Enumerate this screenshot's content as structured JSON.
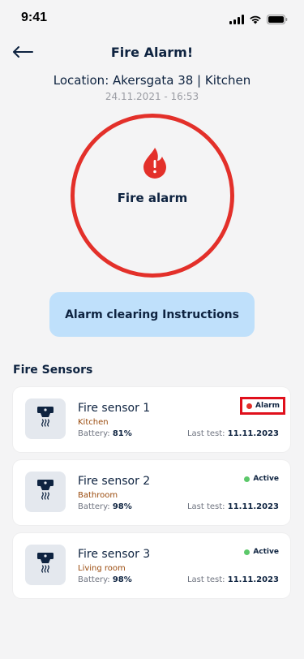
{
  "status_bar": {
    "time": "9:41"
  },
  "header": {
    "title": "Fire Alarm!"
  },
  "event": {
    "location": "Location: Akersgata 38 | Kitchen",
    "timestamp": "24.11.2021 - 16:53",
    "alarm_label": "Fire alarm"
  },
  "instructions_button": {
    "label": "Alarm clearing Instructions"
  },
  "sensors_section": {
    "title": "Fire Sensors",
    "battery_label": "Battery:",
    "last_test_label": "Last test:",
    "items": [
      {
        "name": "Fire sensor 1",
        "room": "Kitchen",
        "battery": "81%",
        "last_test": "11.11.2023",
        "status": "Alarm",
        "status_color": "#e3302a"
      },
      {
        "name": "Fire sensor 2",
        "room": "Bathroom",
        "battery": "98%",
        "last_test": "11.11.2023",
        "status": "Active",
        "status_color": "#5cc86a"
      },
      {
        "name": "Fire sensor 3",
        "room": "Living room",
        "battery": "98%",
        "last_test": "11.11.2023",
        "status": "Active",
        "status_color": "#5cc86a"
      }
    ]
  },
  "colors": {
    "alarm_red": "#e3302a",
    "navy": "#0e2340",
    "button_blue": "#bfe0fb",
    "room_brown": "#9a4a0c"
  },
  "icons": [
    "back-arrow-icon",
    "fire-alert-icon",
    "smoke-detector-icon",
    "signal-icon",
    "wifi-icon",
    "battery-icon"
  ]
}
